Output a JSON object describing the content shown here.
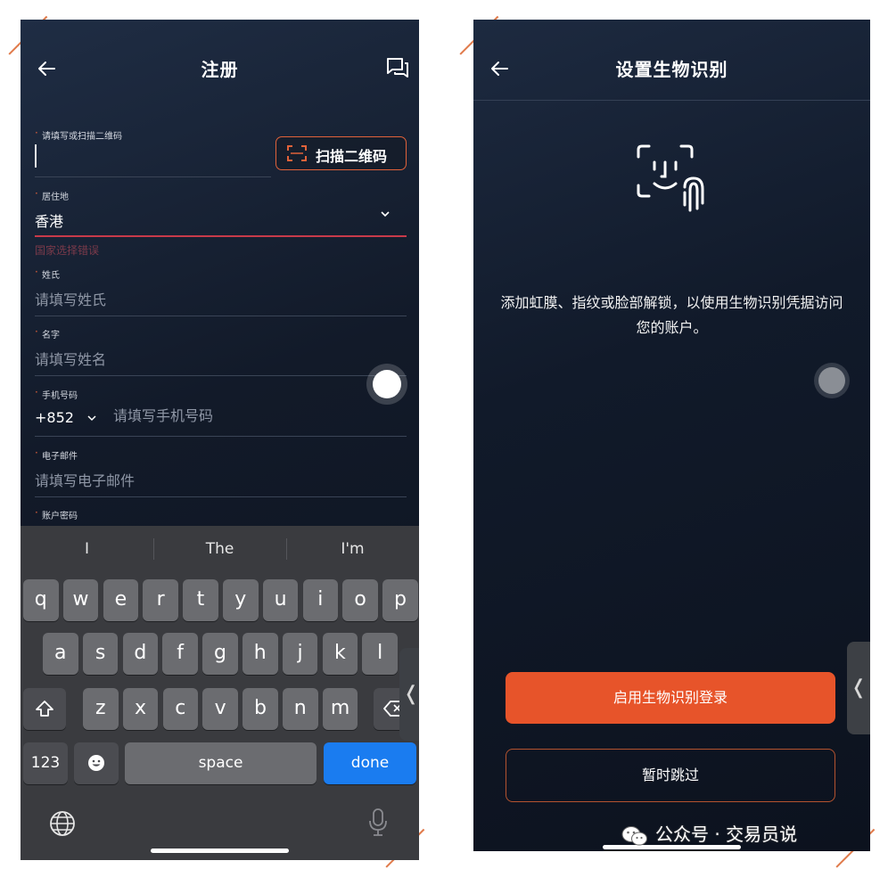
{
  "left_screen": {
    "header": {
      "title": "注册",
      "back_icon": "arrow-left-icon",
      "chat_icon": "chat-bubble-icon"
    },
    "form": {
      "invite": {
        "label": "请填写或扫描二维码",
        "value": "",
        "scan_button": "扫描二维码"
      },
      "residence": {
        "label": "居住地",
        "value": "香港",
        "error": "国家选择错误"
      },
      "surname": {
        "label": "姓氏",
        "placeholder": "请填写姓氏"
      },
      "given_name": {
        "label": "名字",
        "placeholder": "请填写姓名"
      },
      "phone": {
        "label": "手机号码",
        "code": "+852",
        "placeholder": "请填写手机号码"
      },
      "email": {
        "label": "电子邮件",
        "placeholder": "请填写电子邮件"
      },
      "password": {
        "label": "账户密码"
      }
    },
    "keyboard": {
      "suggestions": [
        "I",
        "The",
        "I'm"
      ],
      "row1": [
        "q",
        "w",
        "e",
        "r",
        "t",
        "y",
        "u",
        "i",
        "o",
        "p"
      ],
      "row2": [
        "a",
        "s",
        "d",
        "f",
        "g",
        "h",
        "j",
        "k",
        "l"
      ],
      "row3": [
        "z",
        "x",
        "c",
        "v",
        "b",
        "n",
        "m"
      ],
      "numbers_key": "123",
      "space_key": "space",
      "done_key": "done"
    }
  },
  "right_screen": {
    "header": {
      "title": "设置生物识别",
      "back_icon": "arrow-left-icon"
    },
    "description": "添加虹膜、指纹或脸部解锁，以使用生物识别凭据访问您的账户。",
    "primary_button": "启用生物识别登录",
    "secondary_button": "暂时跳过"
  },
  "watermark": {
    "text": "公众号 · 交易员说"
  },
  "colors": {
    "accent": "#e7542a",
    "done_key": "#1a7cf0",
    "background": "#121a29"
  }
}
